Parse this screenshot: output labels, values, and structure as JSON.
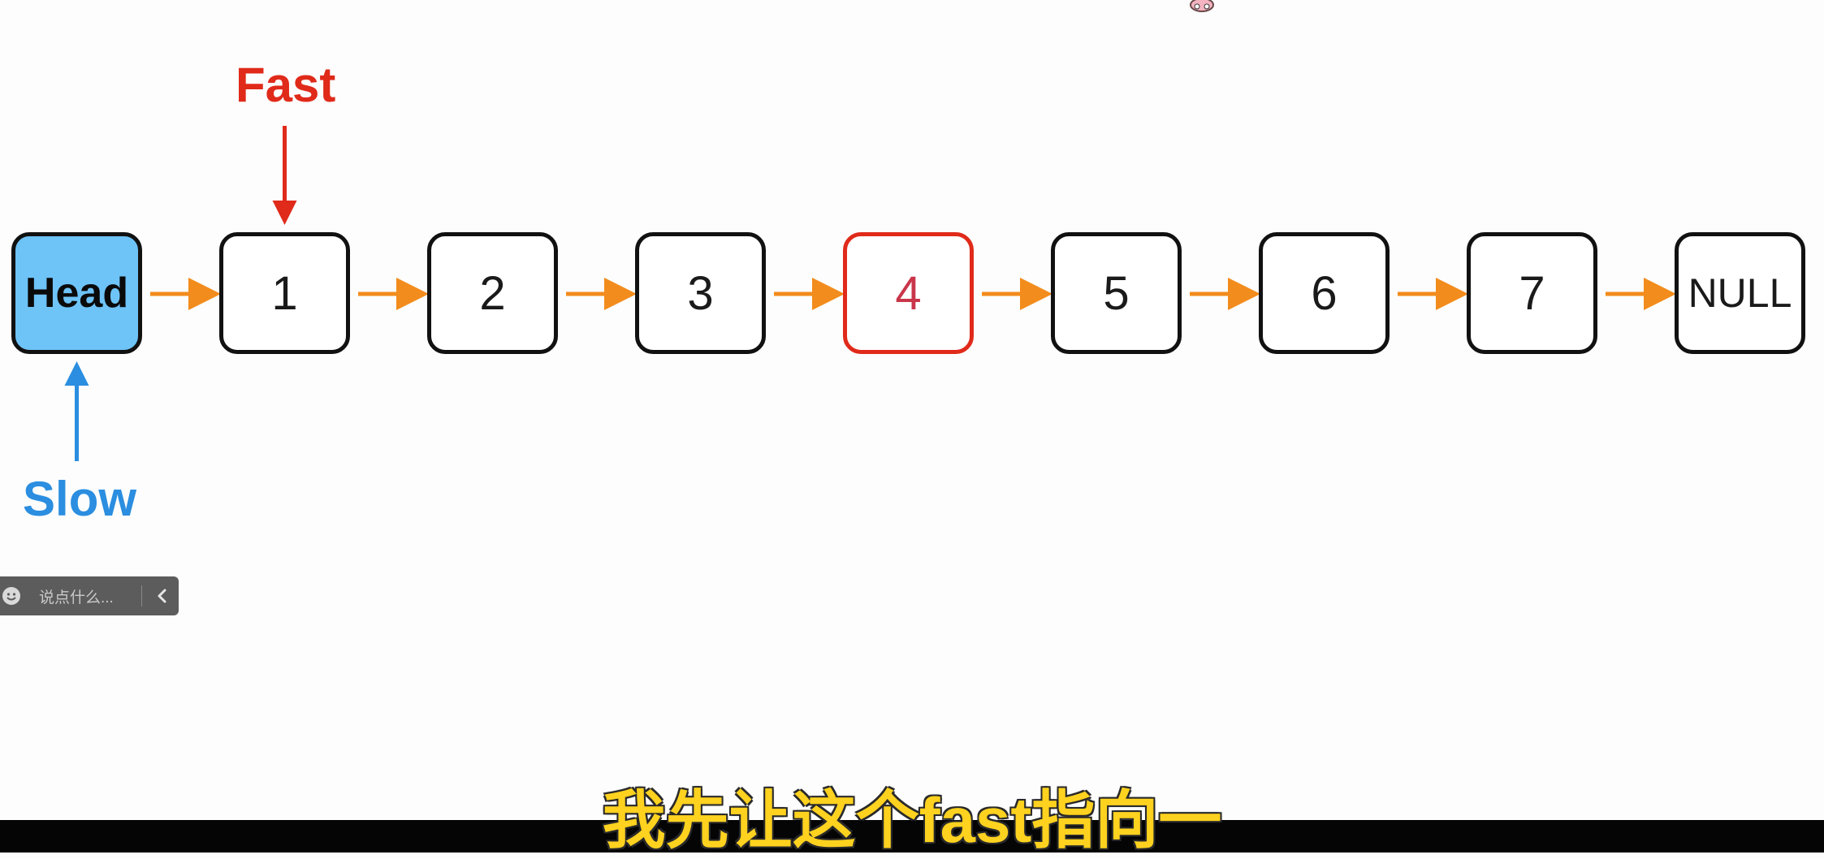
{
  "diagram": {
    "nodes": [
      {
        "label": "Head",
        "kind": "head"
      },
      {
        "label": "1",
        "kind": "normal"
      },
      {
        "label": "2",
        "kind": "normal"
      },
      {
        "label": "3",
        "kind": "normal"
      },
      {
        "label": "4",
        "kind": "highlight"
      },
      {
        "label": "5",
        "kind": "normal"
      },
      {
        "label": "6",
        "kind": "normal"
      },
      {
        "label": "7",
        "kind": "normal"
      },
      {
        "label": "NULL",
        "kind": "null"
      }
    ],
    "pointers": {
      "fast": {
        "label": "Fast",
        "target_node": "1",
        "color": "#e02a1a"
      },
      "slow": {
        "label": "Slow",
        "target_node": "Head",
        "color": "#2b8ee0"
      }
    },
    "colors": {
      "link_arrow": "#f28c1c",
      "head_fill": "#6ec3f7",
      "highlight_border": "#e02a1a",
      "node_border": "#111111"
    }
  },
  "comment_bar": {
    "placeholder": "说点什么...",
    "icon": "smiley-icon",
    "collapse_icon": "chevron-left-icon"
  },
  "subtitle": {
    "text": "我先让这个fast指向一",
    "color": "#ffd21f"
  }
}
